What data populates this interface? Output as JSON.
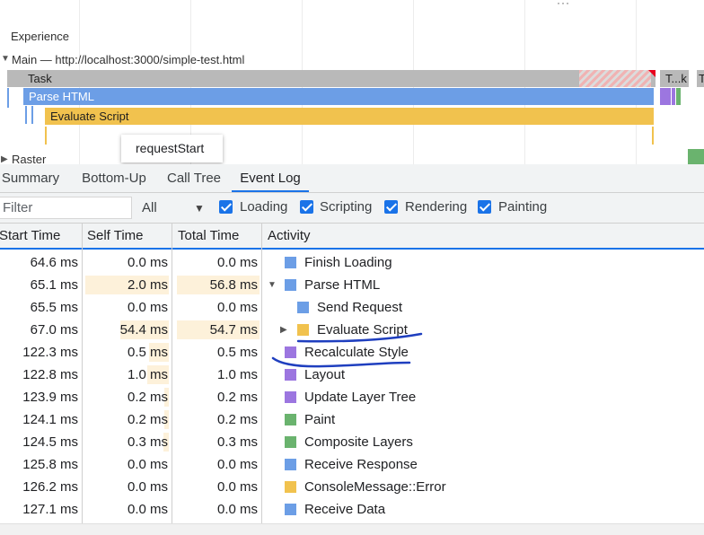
{
  "flame": {
    "experience_label": "Experience",
    "main_label": "Main — http://localhost:3000/simple-test.html",
    "raster_label": "Raster",
    "task_label": "Task",
    "task_short_label": "T...k",
    "task_tiny_label": "T",
    "parse_label": "Parse HTML",
    "evaluate_label": "Evaluate Script",
    "tooltip": "requestStart",
    "colors": {
      "task": "#b9b9b9",
      "loading": "#6c9ee6",
      "scripting": "#f1c24e",
      "rendering": "#9c76e0",
      "painting": "#6ab36e"
    }
  },
  "tabs": [
    {
      "label": "Summary",
      "active": false
    },
    {
      "label": "Bottom-Up",
      "active": false
    },
    {
      "label": "Call Tree",
      "active": false
    },
    {
      "label": "Event Log",
      "active": true
    }
  ],
  "filter": {
    "placeholder": "Filter",
    "duration_select": "All",
    "checkboxes": [
      {
        "label": "Loading",
        "checked": true
      },
      {
        "label": "Scripting",
        "checked": true
      },
      {
        "label": "Rendering",
        "checked": true
      },
      {
        "label": "Painting",
        "checked": true
      }
    ]
  },
  "table": {
    "headers": [
      "Start Time",
      "Self Time",
      "Total Time",
      "Activity"
    ],
    "rows": [
      {
        "start": "64.6 ms",
        "self": "0.0 ms",
        "total": "0.0 ms",
        "activity": "Finish Loading",
        "category": "loading",
        "expander": "",
        "indent": 0
      },
      {
        "start": "65.1 ms",
        "self": "2.0 ms",
        "total": "56.8 ms",
        "activity": "Parse HTML",
        "category": "loading",
        "expander": "▼",
        "indent": 0
      },
      {
        "start": "65.5 ms",
        "self": "0.0 ms",
        "total": "0.0 ms",
        "activity": "Send Request",
        "category": "loading",
        "expander": "",
        "indent": 1
      },
      {
        "start": "67.0 ms",
        "self": "54.4 ms",
        "total": "54.7 ms",
        "activity": "Evaluate Script",
        "category": "scripting",
        "expander": "▶",
        "indent": 1
      },
      {
        "start": "122.3 ms",
        "self": "0.5 ms",
        "total": "0.5 ms",
        "activity": "Recalculate Style",
        "category": "rendering",
        "expander": "",
        "indent": 0
      },
      {
        "start": "122.8 ms",
        "self": "1.0 ms",
        "total": "1.0 ms",
        "activity": "Layout",
        "category": "rendering",
        "expander": "",
        "indent": 0
      },
      {
        "start": "123.9 ms",
        "self": "0.2 ms",
        "total": "0.2 ms",
        "activity": "Update Layer Tree",
        "category": "rendering",
        "expander": "",
        "indent": 0
      },
      {
        "start": "124.1 ms",
        "self": "0.2 ms",
        "total": "0.2 ms",
        "activity": "Paint",
        "category": "painting",
        "expander": "",
        "indent": 0
      },
      {
        "start": "124.5 ms",
        "self": "0.3 ms",
        "total": "0.3 ms",
        "activity": "Composite Layers",
        "category": "painting",
        "expander": "",
        "indent": 0
      },
      {
        "start": "125.8 ms",
        "self": "0.0 ms",
        "total": "0.0 ms",
        "activity": "Receive Response",
        "category": "loading",
        "expander": "",
        "indent": 0
      },
      {
        "start": "126.2 ms",
        "self": "0.0 ms",
        "total": "0.0 ms",
        "activity": "ConsoleMessage::Error",
        "category": "scripting",
        "expander": "",
        "indent": 0
      },
      {
        "start": "127.1 ms",
        "self": "0.0 ms",
        "total": "0.0 ms",
        "activity": "Receive Data",
        "category": "loading",
        "expander": "",
        "indent": 0
      }
    ]
  }
}
